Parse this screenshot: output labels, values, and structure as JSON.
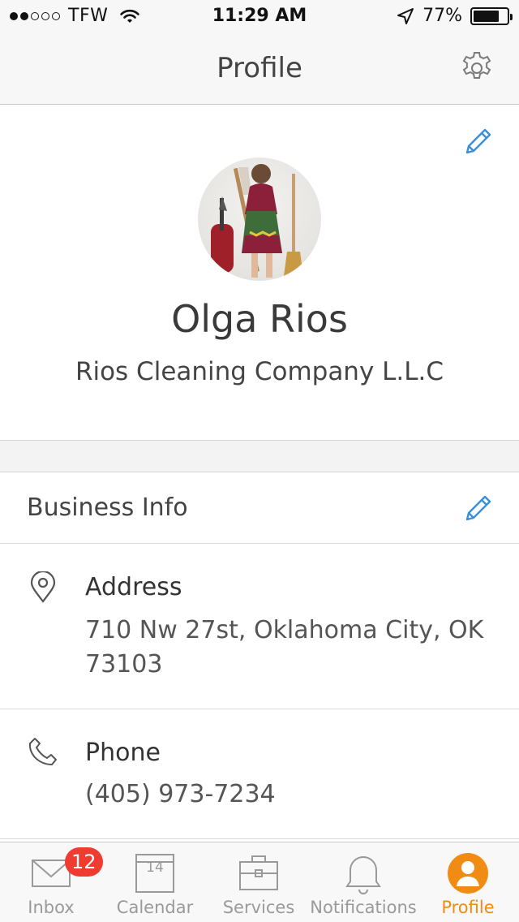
{
  "status_bar": {
    "carrier": "TFW",
    "time": "11:29 AM",
    "battery_percent": "77%",
    "battery_level": 0.77,
    "signal_bars_filled": 2,
    "signal_bars_total": 5
  },
  "nav": {
    "title": "Profile",
    "settings_icon": "gear-icon"
  },
  "profile": {
    "name": "Olga Rios",
    "company": "Rios Cleaning Company L.L.C",
    "edit_icon": "pencil-icon"
  },
  "business_info": {
    "title": "Business Info",
    "edit_icon": "pencil-icon",
    "address": {
      "label": "Address",
      "line1": "710 Nw 27st, Oklahoma City, OK",
      "line2": "73103",
      "icon": "location-pin-icon"
    },
    "phone": {
      "label": "Phone",
      "value": "(405) 973-7234",
      "icon": "phone-icon"
    }
  },
  "tabs": [
    {
      "label": "Inbox",
      "icon": "envelope-icon",
      "badge": "12"
    },
    {
      "label": "Calendar",
      "icon": "calendar-icon",
      "day": "14"
    },
    {
      "label": "Services",
      "icon": "briefcase-icon"
    },
    {
      "label": "Notifications",
      "icon": "bell-icon"
    },
    {
      "label": "Profile",
      "icon": "profile-icon",
      "active": true
    }
  ],
  "colors": {
    "accent_orange": "#f08c13",
    "edit_blue": "#3a8fd9",
    "badge_red": "#f03b30",
    "inactive_gray": "#9a9a9a"
  }
}
